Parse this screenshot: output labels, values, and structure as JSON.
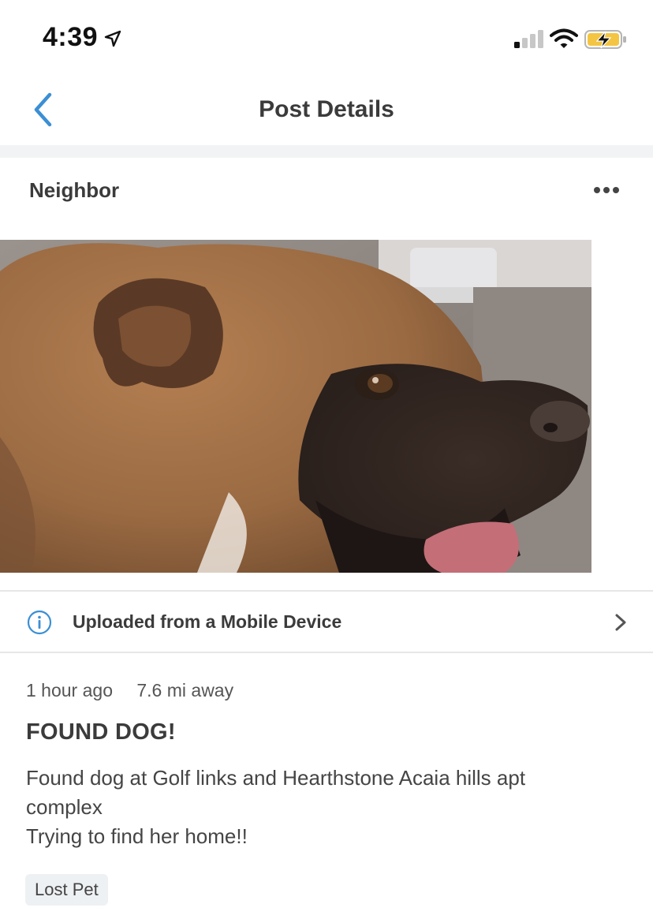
{
  "status_bar": {
    "time": "4:39",
    "icons": [
      "location-arrow-icon",
      "cellular-signal-icon",
      "wifi-icon",
      "battery-charging-icon"
    ]
  },
  "nav": {
    "title": "Post Details",
    "back_icon": "chevron-left-icon",
    "accent_color": "#3b8fd4"
  },
  "post": {
    "author": "Neighbor",
    "more_icon": "ellipsis-icon",
    "photo_description_icon": "dog-photo",
    "upload_info": "Uploaded from a Mobile Device",
    "time_ago": "1 hour ago",
    "distance": "7.6 mi away",
    "title": "FOUND DOG!",
    "body_lines": [
      "Found dog at Golf links and Hearthstone Acaia hills apt",
      "complex",
      "Trying to find her home!!"
    ],
    "tag": "Lost Pet"
  }
}
